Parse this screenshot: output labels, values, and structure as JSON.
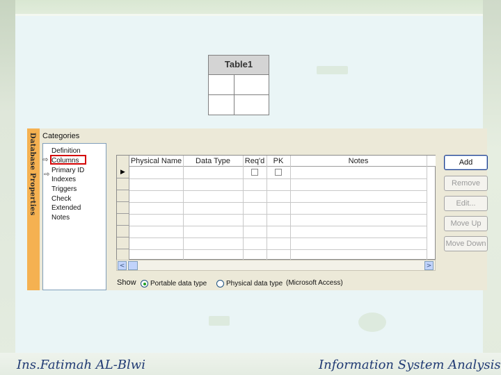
{
  "diagram": {
    "table_title": "Table1"
  },
  "sidebar": {
    "title": "Database Properties"
  },
  "categories": {
    "label": "Categories",
    "items": [
      {
        "label": "Definition"
      },
      {
        "label": "Columns"
      },
      {
        "label": "Primary ID"
      },
      {
        "label": "Indexes"
      },
      {
        "label": "Triggers"
      },
      {
        "label": "Check"
      },
      {
        "label": "Extended"
      },
      {
        "label": "Notes"
      }
    ],
    "selected": "Columns"
  },
  "grid": {
    "columns": [
      "Physical Name",
      "Data Type",
      "Req'd",
      "PK",
      "Notes"
    ],
    "rows": []
  },
  "show": {
    "label": "Show",
    "options": [
      {
        "label": "Portable data type",
        "selected": true
      },
      {
        "label": "Physical data type",
        "selected": false
      }
    ],
    "note": "(Microsoft Access)"
  },
  "buttons": {
    "add": "Add",
    "remove": "Remove",
    "edit": "Edit...",
    "move_up": "Move Up",
    "move_down": "Move Down"
  },
  "footer": {
    "left": "Ins.Fatimah AL-Blwi",
    "right": "Information System Analysis"
  },
  "colors": {
    "sidebar_strip": "#f5b151",
    "selection_box": "#d40000",
    "footer_text": "#203a73"
  },
  "icons": [
    "row-pointer-icon",
    "current-item-arrow-icon",
    "scroll-left-icon",
    "scroll-right-icon"
  ]
}
